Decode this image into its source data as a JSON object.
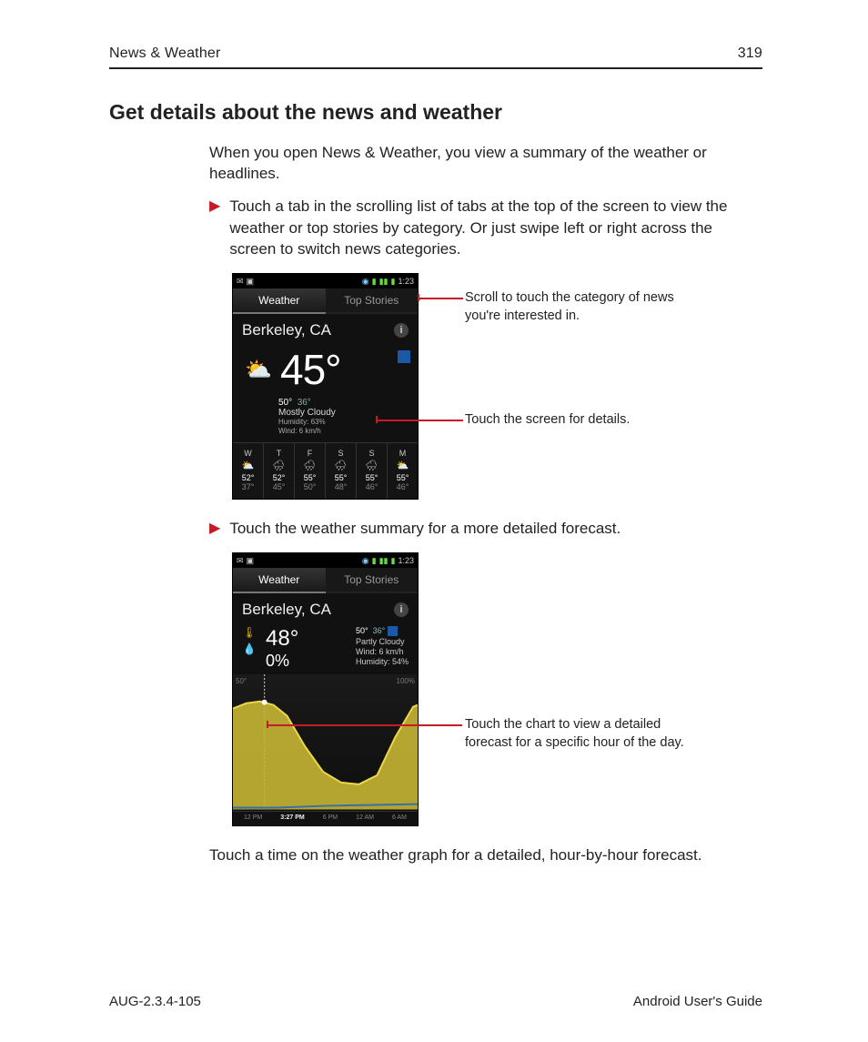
{
  "header": {
    "section": "News & Weather",
    "page_number": "319"
  },
  "title": "Get details about the news and weather",
  "intro": "When you open News & Weather, you view a summary of the weather or headlines.",
  "steps": [
    "Touch a tab in the scrolling list of tabs at the top of the screen to view the weather or top stories by category. Or just swipe left or right across the screen to switch news categories.",
    "Touch the weather summary for a more detailed forecast."
  ],
  "closing": "Touch a time on the weather graph for a detailed, hour-by-hour forecast.",
  "callouts": {
    "a1": "Scroll to touch the category of news",
    "a1b": "you're interested in.",
    "a2": "Touch the screen for details.",
    "b1": "Touch the chart to view a detailed",
    "b1b": "forecast for a specific hour of the day."
  },
  "phone1": {
    "time": "1:23",
    "tabs": [
      "Weather",
      "Top Stories"
    ],
    "location": "Berkeley, CA",
    "temp": "45°",
    "hi": "50°",
    "lo": "36°",
    "cond": "Mostly Cloudy",
    "humidity": "Humidity: 63%",
    "wind": "Wind: 6 km/h",
    "forecast": [
      {
        "d": "W",
        "hi": "52°",
        "lo": "37°"
      },
      {
        "d": "T",
        "hi": "52°",
        "lo": "45°"
      },
      {
        "d": "F",
        "hi": "55°",
        "lo": "50°"
      },
      {
        "d": "S",
        "hi": "55°",
        "lo": "48°"
      },
      {
        "d": "S",
        "hi": "55°",
        "lo": "46°"
      },
      {
        "d": "M",
        "hi": "55°",
        "lo": "46°"
      }
    ]
  },
  "phone2": {
    "time": "1:23",
    "tabs": [
      "Weather",
      "Top Stories"
    ],
    "location": "Berkeley, CA",
    "temp": "48°",
    "precip": "0%",
    "hi": "50°",
    "lo": "36°",
    "cond": "Partly Cloudy",
    "wind": "Wind: 6 km/h",
    "humidity": "Humidity: 54%",
    "axis_left": "50°",
    "axis_right": "100%",
    "timebar": [
      "12 PM",
      "3:27 PM",
      "6 PM",
      "12 AM",
      "6 AM"
    ]
  },
  "footer": {
    "left": "AUG-2.3.4-105",
    "right": "Android User's Guide"
  }
}
